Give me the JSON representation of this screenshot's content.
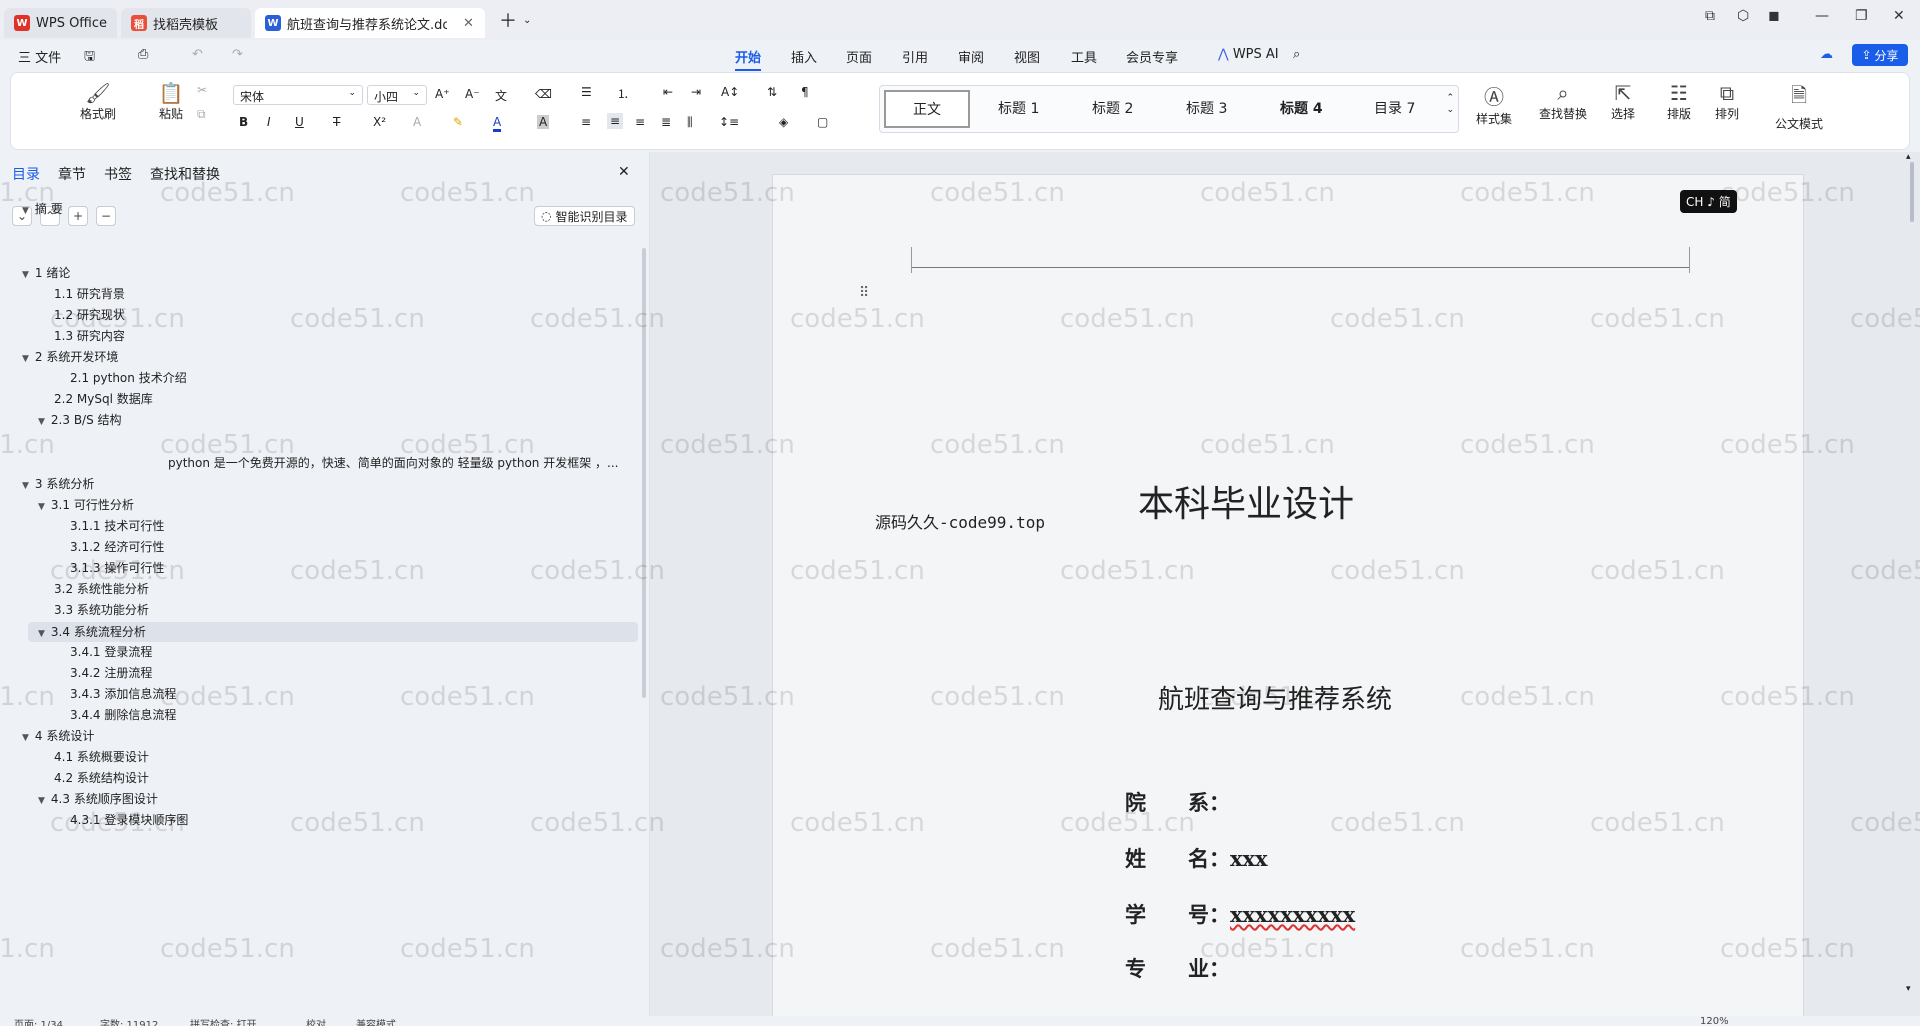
{
  "tabs": [
    {
      "label": "WPS Office",
      "icon": "wps-icon"
    },
    {
      "label": "找稻壳模板",
      "icon": "docer-icon"
    },
    {
      "label": "航班查询与推荐系统论文.do",
      "icon": "word-doc-icon"
    }
  ],
  "menu": {
    "file": "三 文件",
    "items": [
      "开始",
      "插入",
      "页面",
      "引用",
      "审阅",
      "视图",
      "工具",
      "会员专享"
    ],
    "wps_ai": "WPS AI",
    "share": "分享"
  },
  "ribbon": {
    "format_painter": "格式刷",
    "paste": "粘贴",
    "font_name": "宋体",
    "font_size": "小四",
    "styles": [
      "正文",
      "标题 1",
      "标题 2",
      "标题 3",
      "标题 4",
      "目录 7"
    ],
    "style_set": "样式集",
    "find_replace": "查找替换",
    "select": "选择",
    "layout": "排版",
    "arrange": "排列",
    "official_mode": "公文模式"
  },
  "sidebar": {
    "tabs": [
      "目录",
      "章节",
      "书签",
      "查找和替换"
    ],
    "smart_toc": "智能识别目录",
    "toc": [
      {
        "label": "摘 要",
        "level": 0,
        "expanded": true
      },
      {
        "label": "1 绪论",
        "level": 0,
        "expanded": true
      },
      {
        "label": "1.1 研究背景",
        "level": 1
      },
      {
        "label": "1.2 研究现状",
        "level": 1
      },
      {
        "label": "1.3 研究内容",
        "level": 1
      },
      {
        "label": "2 系统开发环境",
        "level": 0,
        "expanded": true
      },
      {
        "label": "2.1    python 技术介绍",
        "level": 2
      },
      {
        "label": "2.2 MySql 数据库",
        "level": 1
      },
      {
        "label": "2.3 B/S 结构",
        "level": 1,
        "expanded": true
      },
      {
        "label": "python 是一个免费开源的，快速、简单的面向对象的 轻量级 python 开发框架 ，...",
        "level": 3
      },
      {
        "label": "3 系统分析",
        "level": 0,
        "expanded": true
      },
      {
        "label": "3.1 可行性分析",
        "level": 1,
        "expanded": true
      },
      {
        "label": "3.1.1 技术可行性",
        "level": 2
      },
      {
        "label": "3.1.2 经济可行性",
        "level": 2
      },
      {
        "label": "3.1.3 操作可行性",
        "level": 2
      },
      {
        "label": "3.2 系统性能分析",
        "level": 1
      },
      {
        "label": "3.3 系统功能分析",
        "level": 1
      },
      {
        "label": "3.4 系统流程分析",
        "level": 1,
        "expanded": true,
        "selected": true
      },
      {
        "label": "3.4.1 登录流程",
        "level": 2
      },
      {
        "label": "3.4.2 注册流程",
        "level": 2
      },
      {
        "label": "3.4.3 添加信息流程",
        "level": 2
      },
      {
        "label": "3.4.4 删除信息流程",
        "level": 2
      },
      {
        "label": "4 系统设计",
        "level": 0,
        "expanded": true
      },
      {
        "label": "4.1 系统概要设计",
        "level": 1
      },
      {
        "label": "4.2 系统结构设计",
        "level": 1
      },
      {
        "label": "4.3 系统顺序图设计",
        "level": 1,
        "expanded": true
      },
      {
        "label": "4.3.1 登录模块顺序图",
        "level": 2
      }
    ]
  },
  "document": {
    "source_note": "源码久久-code99.top",
    "main_title": "本科毕业设计",
    "thesis_title": "航班查询与推荐系统",
    "fields": [
      {
        "label": "院　　系：",
        "value": ""
      },
      {
        "label": "姓　　名：",
        "value": "xxx"
      },
      {
        "label": "学　　号：",
        "value": "xxxxxxxxxx"
      },
      {
        "label": "专　　业：",
        "value": ""
      }
    ],
    "ime_badge": "CH ♪ 简"
  },
  "watermark": "code51.cn",
  "status": {
    "page": "页面: 1/34",
    "words": "字数: 11912",
    "spell": "拼写检查: 打开",
    "proof": "校对",
    "compat": "兼容模式",
    "zoom": "120%"
  },
  "colors": {
    "accent": "#1a5de8",
    "wps_red": "#e0322a"
  }
}
